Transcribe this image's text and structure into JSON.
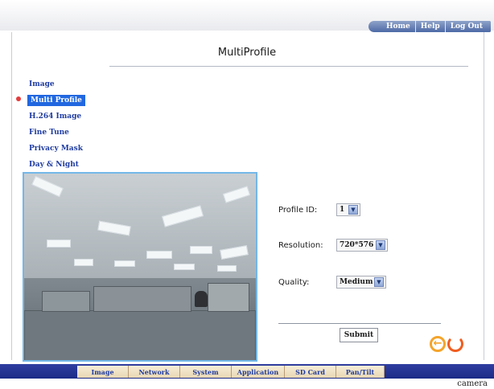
{
  "top_nav": {
    "links": [
      "Home",
      "Help",
      "Log Out"
    ]
  },
  "page": {
    "title": "MultiProfile"
  },
  "sidebar": {
    "items": [
      {
        "label": "Image"
      },
      {
        "label": "Multi Profile"
      },
      {
        "label": "H.264 Image"
      },
      {
        "label": "Fine Tune"
      },
      {
        "label": "Privacy Mask"
      },
      {
        "label": "Day & Night"
      }
    ]
  },
  "form": {
    "profile_id": {
      "label": "Profile ID:",
      "value": "1"
    },
    "resolution": {
      "label": "Resolution:",
      "value": "720*576"
    },
    "quality": {
      "label": "Quality:",
      "value": "Medium"
    },
    "submit_label": "Submit"
  },
  "bottom_tabs": [
    "Image",
    "Network",
    "System",
    "Application",
    "SD Card",
    "Pan/Tilt"
  ],
  "brand": "camera",
  "colors": {
    "primary_blue": "#2167e0",
    "nav_bar": "#1b2b86",
    "tab_bg": "#f2e3c5",
    "accent_orange": "#f4a42b"
  }
}
